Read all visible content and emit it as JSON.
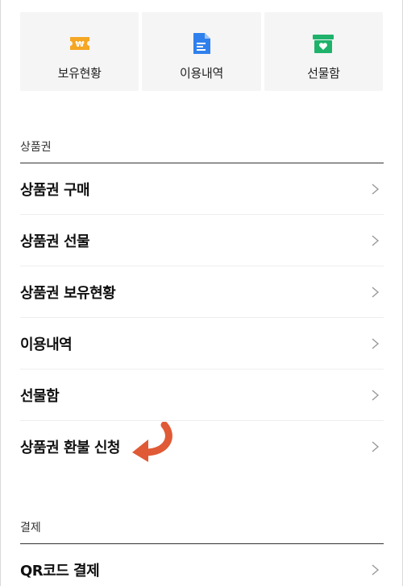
{
  "top_cards": [
    {
      "label": "보유현황",
      "icon": "won-ticket-icon",
      "color": "#f5a623"
    },
    {
      "label": "이용내역",
      "icon": "document-icon",
      "color": "#2f80ed"
    },
    {
      "label": "선물함",
      "icon": "gift-box-icon",
      "color": "#1fb26b"
    }
  ],
  "sections": [
    {
      "title": "상품권",
      "items": [
        {
          "label": "상품권 구매"
        },
        {
          "label": "상품권 선물"
        },
        {
          "label": "상품권 보유현황"
        },
        {
          "label": "이용내역"
        },
        {
          "label": "선물함"
        },
        {
          "label": "상품권 환불 신청"
        }
      ]
    },
    {
      "title": "결제",
      "items": [
        {
          "label": "QR코드 결제"
        }
      ]
    }
  ],
  "colors": {
    "accent_arrow": "#e05a35",
    "divider": "#333333",
    "card_bg": "#f5f5f5"
  }
}
